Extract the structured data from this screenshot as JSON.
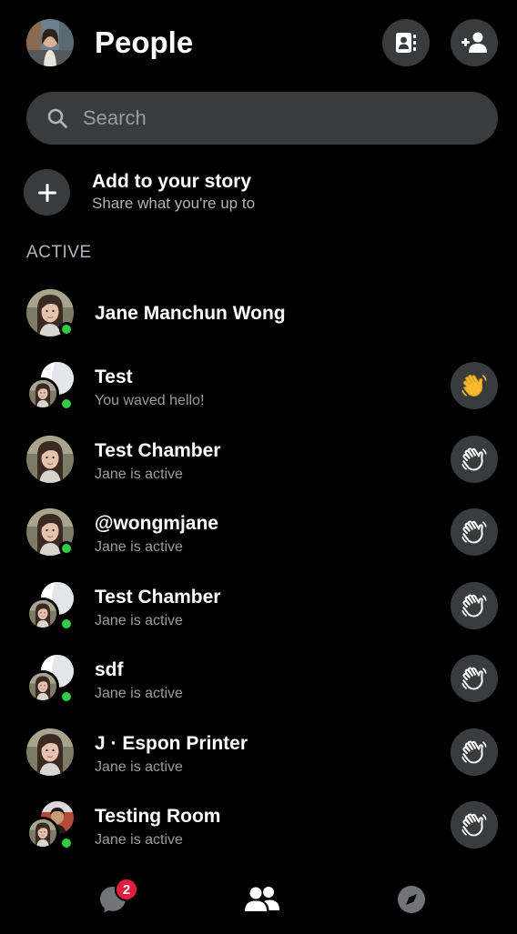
{
  "header": {
    "title": "People",
    "contacts_icon": "contacts-book-icon",
    "add_person_icon": "add-person-icon"
  },
  "search": {
    "placeholder": "Search",
    "value": ""
  },
  "story": {
    "title": "Add to your story",
    "subtitle": "Share what you're up to"
  },
  "section": {
    "active_label": "ACTIVE"
  },
  "contacts": [
    {
      "name": "Jane Manchun Wong",
      "status": "",
      "avatar": "single",
      "online": true,
      "wave": "none"
    },
    {
      "name": "Test",
      "status": "You waved hello!",
      "avatar": "group",
      "online": true,
      "wave": "waved"
    },
    {
      "name": "Test Chamber",
      "status": "Jane is active",
      "avatar": "single",
      "online": false,
      "wave": "outline"
    },
    {
      "name": "@wongmjane",
      "status": "Jane is active",
      "avatar": "single",
      "online": true,
      "wave": "outline"
    },
    {
      "name": "Test Chamber",
      "status": "Jane is active",
      "avatar": "group",
      "online": true,
      "wave": "outline"
    },
    {
      "name": "sdf",
      "status": "Jane is active",
      "avatar": "group",
      "online": true,
      "wave": "outline"
    },
    {
      "name": "J · Espon Printer",
      "status": "Jane is active",
      "avatar": "single",
      "online": false,
      "wave": "outline"
    },
    {
      "name": "Testing Room",
      "status": "Jane is active",
      "avatar": "group-photo",
      "online": true,
      "wave": "outline"
    }
  ],
  "bottom_nav": {
    "chats_badge": "2",
    "items": [
      "chats-icon",
      "people-icon",
      "discover-icon"
    ]
  },
  "colors": {
    "background": "#000000",
    "surface": "#3a3b3c",
    "secondary_text": "#9a9b9d",
    "presence_green": "#31cc46",
    "badge_red": "#e41e3f",
    "wave_yellow": "#f5b82e"
  }
}
